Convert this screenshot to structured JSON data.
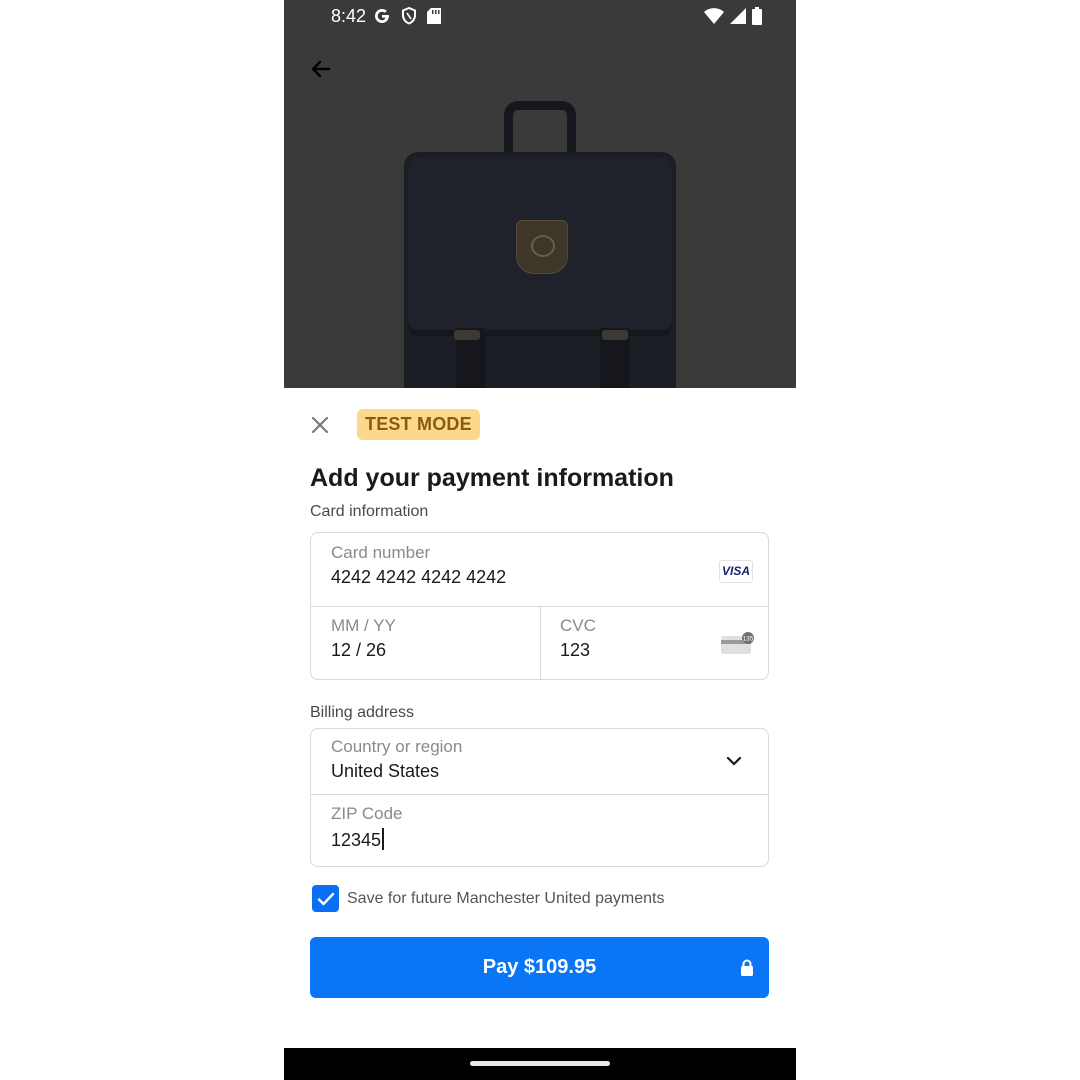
{
  "status_bar": {
    "time": "8:42",
    "left_icons": [
      "google-icon",
      "shield-icon",
      "sd-card-icon"
    ],
    "right_icons": [
      "wifi-icon",
      "signal-icon",
      "battery-icon"
    ]
  },
  "product": {
    "image": "backpack-image"
  },
  "sheet": {
    "badge": "TEST MODE",
    "title": "Add your payment information",
    "card_section_label": "Card information",
    "card_number_label": "Card number",
    "card_number_value": "4242 4242 4242 4242",
    "card_brand": "VISA",
    "expiry_label": "MM / YY",
    "expiry_value": "12 / 26",
    "cvc_label": "CVC",
    "cvc_value": "123",
    "cvc_icon_text": "135",
    "billing_section_label": "Billing address",
    "country_label": "Country or region",
    "country_value": "United States",
    "zip_label": "ZIP Code",
    "zip_value": "12345",
    "save_checked": true,
    "save_label": "Save for future Manchester United payments",
    "pay_label": "Pay $109.95"
  },
  "colors": {
    "accent": "#0a75f5",
    "badge_bg": "#fcd88c",
    "badge_text": "#8a5a12"
  }
}
